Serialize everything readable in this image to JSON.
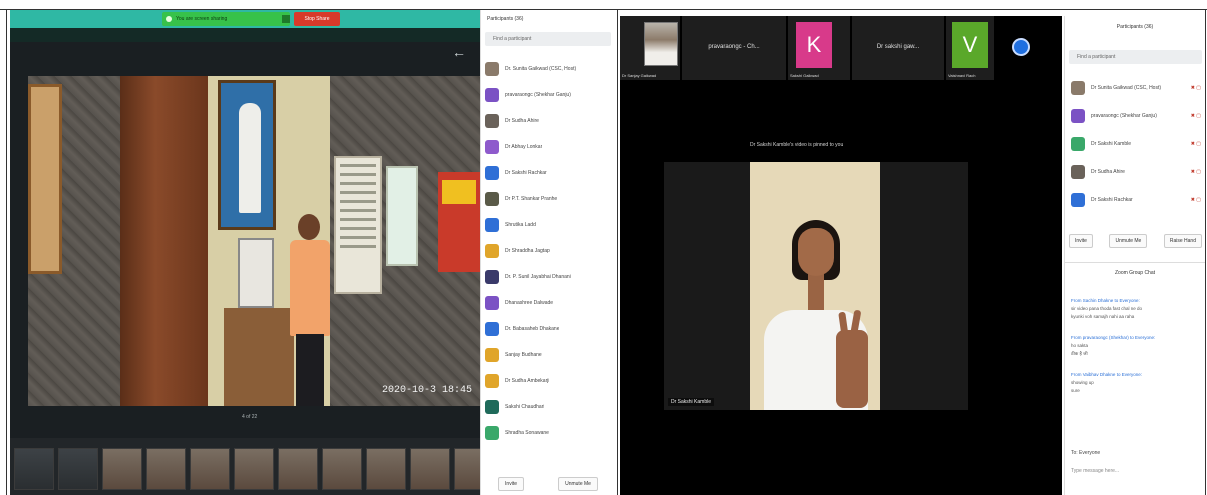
{
  "left_screen": {
    "share_bar": {
      "text": "You are screen sharing",
      "stop_label": "Stop Share"
    },
    "timestamp": "2020-10-3 18:45",
    "caption": "4 of 22",
    "panel": {
      "title": "Participants (36)",
      "search_placeholder": "Find a participant",
      "participants": [
        {
          "name": "Dr. Sunita Gaikwad (CSC, Host)",
          "color": "#8a7a6a"
        },
        {
          "name": "pravaraongc (Shekhar Ganju)",
          "color": "#7b52c4"
        },
        {
          "name": "Dr Sudha Ahire",
          "color": "#6a625a"
        },
        {
          "name": "Dr Abhay Lonkar",
          "color": "#8e5acc"
        },
        {
          "name": "Dr Sakshi Rachkar",
          "color": "#2f6fd6"
        },
        {
          "name": "Dr P.T. Shankar Pranhe",
          "color": "#5a5a48"
        },
        {
          "name": "Shrutika Ladd",
          "color": "#2f6fd6"
        },
        {
          "name": "Dr Shraddha Jagtap",
          "color": "#e0a52a"
        },
        {
          "name": "Dr. P. Sunil Jayabhai Dhanani",
          "color": "#3a3a6a"
        },
        {
          "name": "Dhanashree Dalwade",
          "color": "#7b52c4"
        },
        {
          "name": "Dr. Babasaheb Dhakane",
          "color": "#2f6fd6"
        },
        {
          "name": "Sanjay Budhane",
          "color": "#e0a52a"
        },
        {
          "name": "Dr Sudha Ambekarji",
          "color": "#e0a52a"
        },
        {
          "name": "Sakshi Chaudhari",
          "color": "#1f6a5a"
        },
        {
          "name": "Shradha Sonawane",
          "color": "#3aa86a"
        }
      ],
      "buttons": {
        "invite": "Invite",
        "mute_all": "Unmute Me"
      }
    }
  },
  "right_screen": {
    "tiles": [
      {
        "caption": "Dr Sanjay Gaikwad",
        "name": "",
        "letter": "",
        "color": ""
      },
      {
        "caption": "",
        "name": "pravaraongc - Ch...",
        "letter": "",
        "color": ""
      },
      {
        "caption": "Sakshi Gaikwad",
        "name": "",
        "letter": "K",
        "color": "#d83a8a"
      },
      {
        "caption": "",
        "name": "Dr sakshi gaw...",
        "letter": "",
        "color": ""
      },
      {
        "caption": "Vaishnavi Rach",
        "name": "",
        "letter": "V",
        "color": "#5aa82a"
      }
    ],
    "speaker_label": "Dr Sakshi Kamble's video is pinned to you",
    "video_name": "Dr Sakshi Kamble",
    "panel": {
      "title": "Participants (36)",
      "search_placeholder": "Find a participant",
      "participants": [
        {
          "name": "Dr Sunita Gaikwad (CSC, Host)",
          "color": "#8a7a6a"
        },
        {
          "name": "pravaraongc (Shekhar Ganju)",
          "color": "#7b52c4"
        },
        {
          "name": "Dr Sakshi Kamble",
          "color": "#3aa86a"
        },
        {
          "name": "Dr Sudha Ahire",
          "color": "#6a625a"
        },
        {
          "name": "Dr Sakshi Rachkar",
          "color": "#2f6fd6"
        }
      ],
      "buttons": {
        "invite": "Invite",
        "unmute": "Unmute Me",
        "raise": "Raise Hand"
      },
      "chat_title": "Zoom Group Chat",
      "messages": [
        {
          "from": "From Sachin Dhakne to Everyone:",
          "lines": [
            "sir video pana thoda fast chal ne do",
            "kyunki voh samajh nahi aa raha"
          ]
        },
        {
          "from": "From pravaraongc (Shekhar) to Everyone:",
          "lines": [
            "ho sakta",
            "ठीक है जी"
          ]
        },
        {
          "from": "From Vaibhav Dhakne to Everyone:",
          "lines": [
            "showing up",
            "sure"
          ]
        }
      ],
      "to_label": "To: Everyone",
      "input_placeholder": "Type message here..."
    }
  }
}
